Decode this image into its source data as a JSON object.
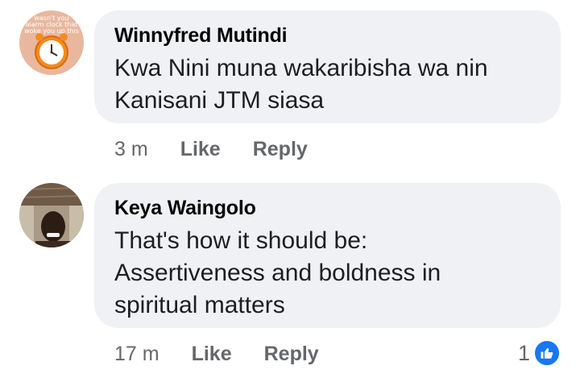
{
  "comments": [
    {
      "author": "Winnyfred Mutindi",
      "text_lines": [
        "Kwa Nini muna wakaribisha wa nin",
        "Kanisani JTM siasa"
      ],
      "time": "3 m",
      "like_label": "Like",
      "reply_label": "Reply",
      "avatar_caption": "wasn't you alarm clock that woke you up this"
    },
    {
      "author": "Keya Waingolo",
      "text_lines": [
        "That's how it should be:",
        "Assertiveness and boldness in",
        "spiritual matters"
      ],
      "time": "17 m",
      "like_label": "Like",
      "reply_label": "Reply",
      "reaction_count": "1"
    }
  ],
  "colors": {
    "bubble": "#eff1f4",
    "meta_text": "#65676b",
    "like_blue": "#1877f2",
    "avatar1_bg": "#e9b79d",
    "clock_orange": "#f58a1f"
  },
  "icons": {
    "reaction": "thumbs-up-icon"
  }
}
